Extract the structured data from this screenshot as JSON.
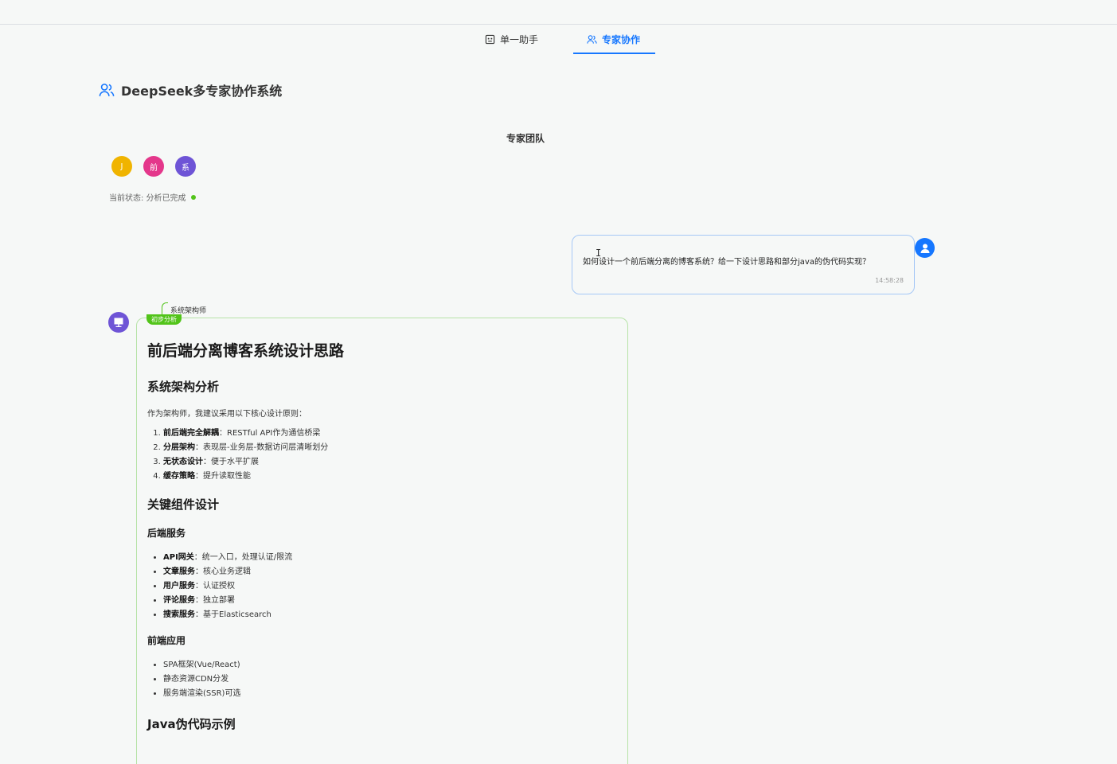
{
  "tabs": [
    {
      "label": "单一助手",
      "icon": "robot-icon"
    },
    {
      "label": "专家协作",
      "icon": "team-icon"
    }
  ],
  "header": {
    "title": "DeepSeek多专家协作系统"
  },
  "team": {
    "title": "专家团队",
    "members": [
      {
        "initial": "J",
        "color": "#f0b400"
      },
      {
        "initial": "前",
        "color": "#e4378b"
      },
      {
        "initial": "系",
        "color": "#6e54d6"
      }
    ],
    "status": "当前状态: 分析已完成"
  },
  "user_message": {
    "text": "如何设计一个前后端分离的博客系统？给一下设计思路和部分java的伪代码实现？",
    "time": "14:58:28"
  },
  "expert_message": {
    "role": "系统架构师",
    "phase": "初步分析",
    "h1": "前后端分离博客系统设计思路",
    "section1_title": "系统架构分析",
    "intro": "作为架构师，我建议采用以下核心设计原则：",
    "principles": [
      {
        "bold": "前后端完全解耦",
        "text": "：RESTful API作为通信桥梁"
      },
      {
        "bold": "分层架构",
        "text": "：表现层-业务层-数据访问层清晰划分"
      },
      {
        "bold": "无状态设计",
        "text": "：便于水平扩展"
      },
      {
        "bold": "缓存策略",
        "text": "：提升读取性能"
      }
    ],
    "section2_title": "关键组件设计",
    "backend_title": "后端服务",
    "backend_items": [
      {
        "bold": "API网关",
        "text": "：统一入口，处理认证/限流"
      },
      {
        "bold": "文章服务",
        "text": "：核心业务逻辑"
      },
      {
        "bold": "用户服务",
        "text": "：认证授权"
      },
      {
        "bold": "评论服务",
        "text": "：独立部署"
      },
      {
        "bold": "搜索服务",
        "text": "：基于Elasticsearch"
      }
    ],
    "frontend_title": "前端应用",
    "frontend_items": [
      "SPA框架(Vue/React)",
      "静态资源CDN分发",
      "服务端渲染(SSR)可选"
    ],
    "section3_title": "Java伪代码示例"
  },
  "colors": {
    "accent": "#1677ff",
    "success": "#52c41a"
  }
}
